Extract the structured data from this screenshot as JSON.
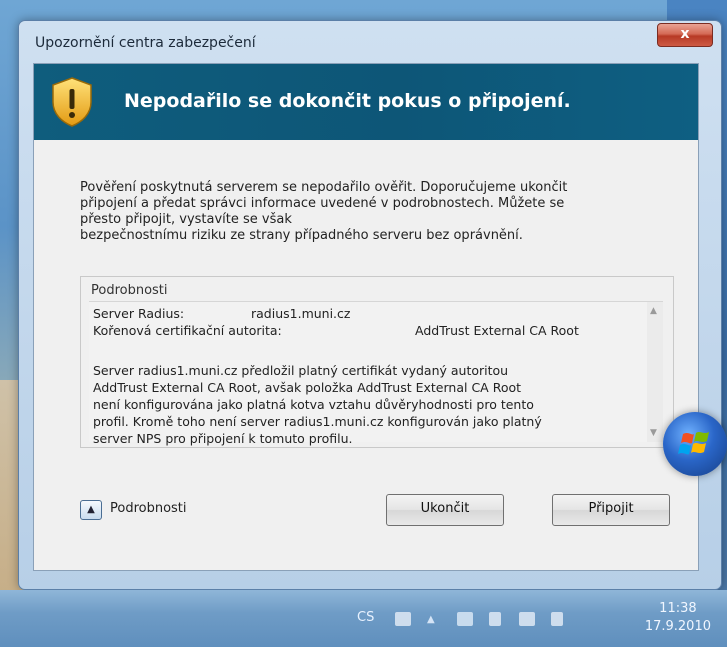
{
  "window": {
    "title": "Upozornění centra zabezpečení",
    "close_label": "x"
  },
  "banner": {
    "icon": "shield-warning-icon",
    "title": "Nepodařilo se dokončit pokus o připojení."
  },
  "message": "Pověření poskytnutá serverem se nepodařilo ověřit. Doporučujeme ukončit\npřipojení a předat správci informace uvedené v podrobnostech. Můžete se\npřesto připojit, vystavíte se však\nbezpečnostnímu riziku ze strany případného serveru bez oprávnění.",
  "details": {
    "legend": "Podrobnosti",
    "server_key": "Server Radius:",
    "server_value": "radius1.muni.cz",
    "ca_key": "Kořenová certifikační autorita:",
    "ca_value": "AddTrust External CA Root",
    "description": "Server radius1.muni.cz předložil platný certifikát vydaný autoritou\nAddTrust External CA Root, avšak položka AddTrust External CA Root\nnení konfigurována jako platná kotva vztahu důvěryhodnosti pro tento\nprofil. Kromě toho není server radius1.muni.cz konfigurován jako platný\nserver NPS pro připojení k tomuto profilu."
  },
  "footer": {
    "toggle_label": "Podrobnosti",
    "cancel_button": "Ukončit",
    "connect_button": "Připojit"
  },
  "taskbar": {
    "language": "CS",
    "time": "11:38",
    "date": "17.9.2010"
  },
  "colors": {
    "banner": "#0f5d7d",
    "close_button": "#c6503b"
  }
}
